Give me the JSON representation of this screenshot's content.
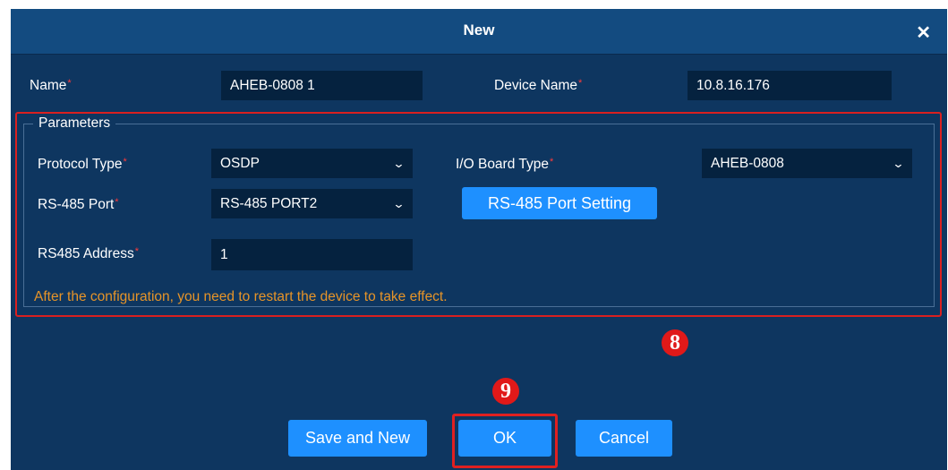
{
  "dialog": {
    "title": "New",
    "close_icon": "✕"
  },
  "form": {
    "name_label": "Name",
    "name_value": "AHEB-0808 1",
    "device_name_label": "Device Name",
    "device_name_value": "10.8.16.176"
  },
  "parameters": {
    "legend": "Parameters",
    "protocol_type_label": "Protocol Type",
    "protocol_type_value": "OSDP",
    "io_board_type_label": "I/O Board Type",
    "io_board_type_value": "AHEB-0808",
    "rs485_port_label": "RS-485 Port",
    "rs485_port_value": "RS-485 PORT2",
    "rs485_port_setting_button": "RS-485 Port Setting",
    "rs485_address_label": "RS485 Address",
    "rs485_address_value": "1",
    "note": "After the configuration, you need to restart the device to take effect."
  },
  "required_mark": "*",
  "chevron_icon": "⌄",
  "annotations": {
    "marker_8": "8",
    "marker_9": "9"
  },
  "buttons": {
    "save_and_new": "Save and New",
    "ok": "OK",
    "cancel": "Cancel"
  },
  "colors": {
    "dialog_background": "#0e3660",
    "titlebar": "#134b80",
    "field_background": "#05223f",
    "button_blue": "#1e90ff",
    "required_red": "#ff3b3b",
    "annotation_red": "#e01919",
    "note_orange": "#e69428"
  }
}
